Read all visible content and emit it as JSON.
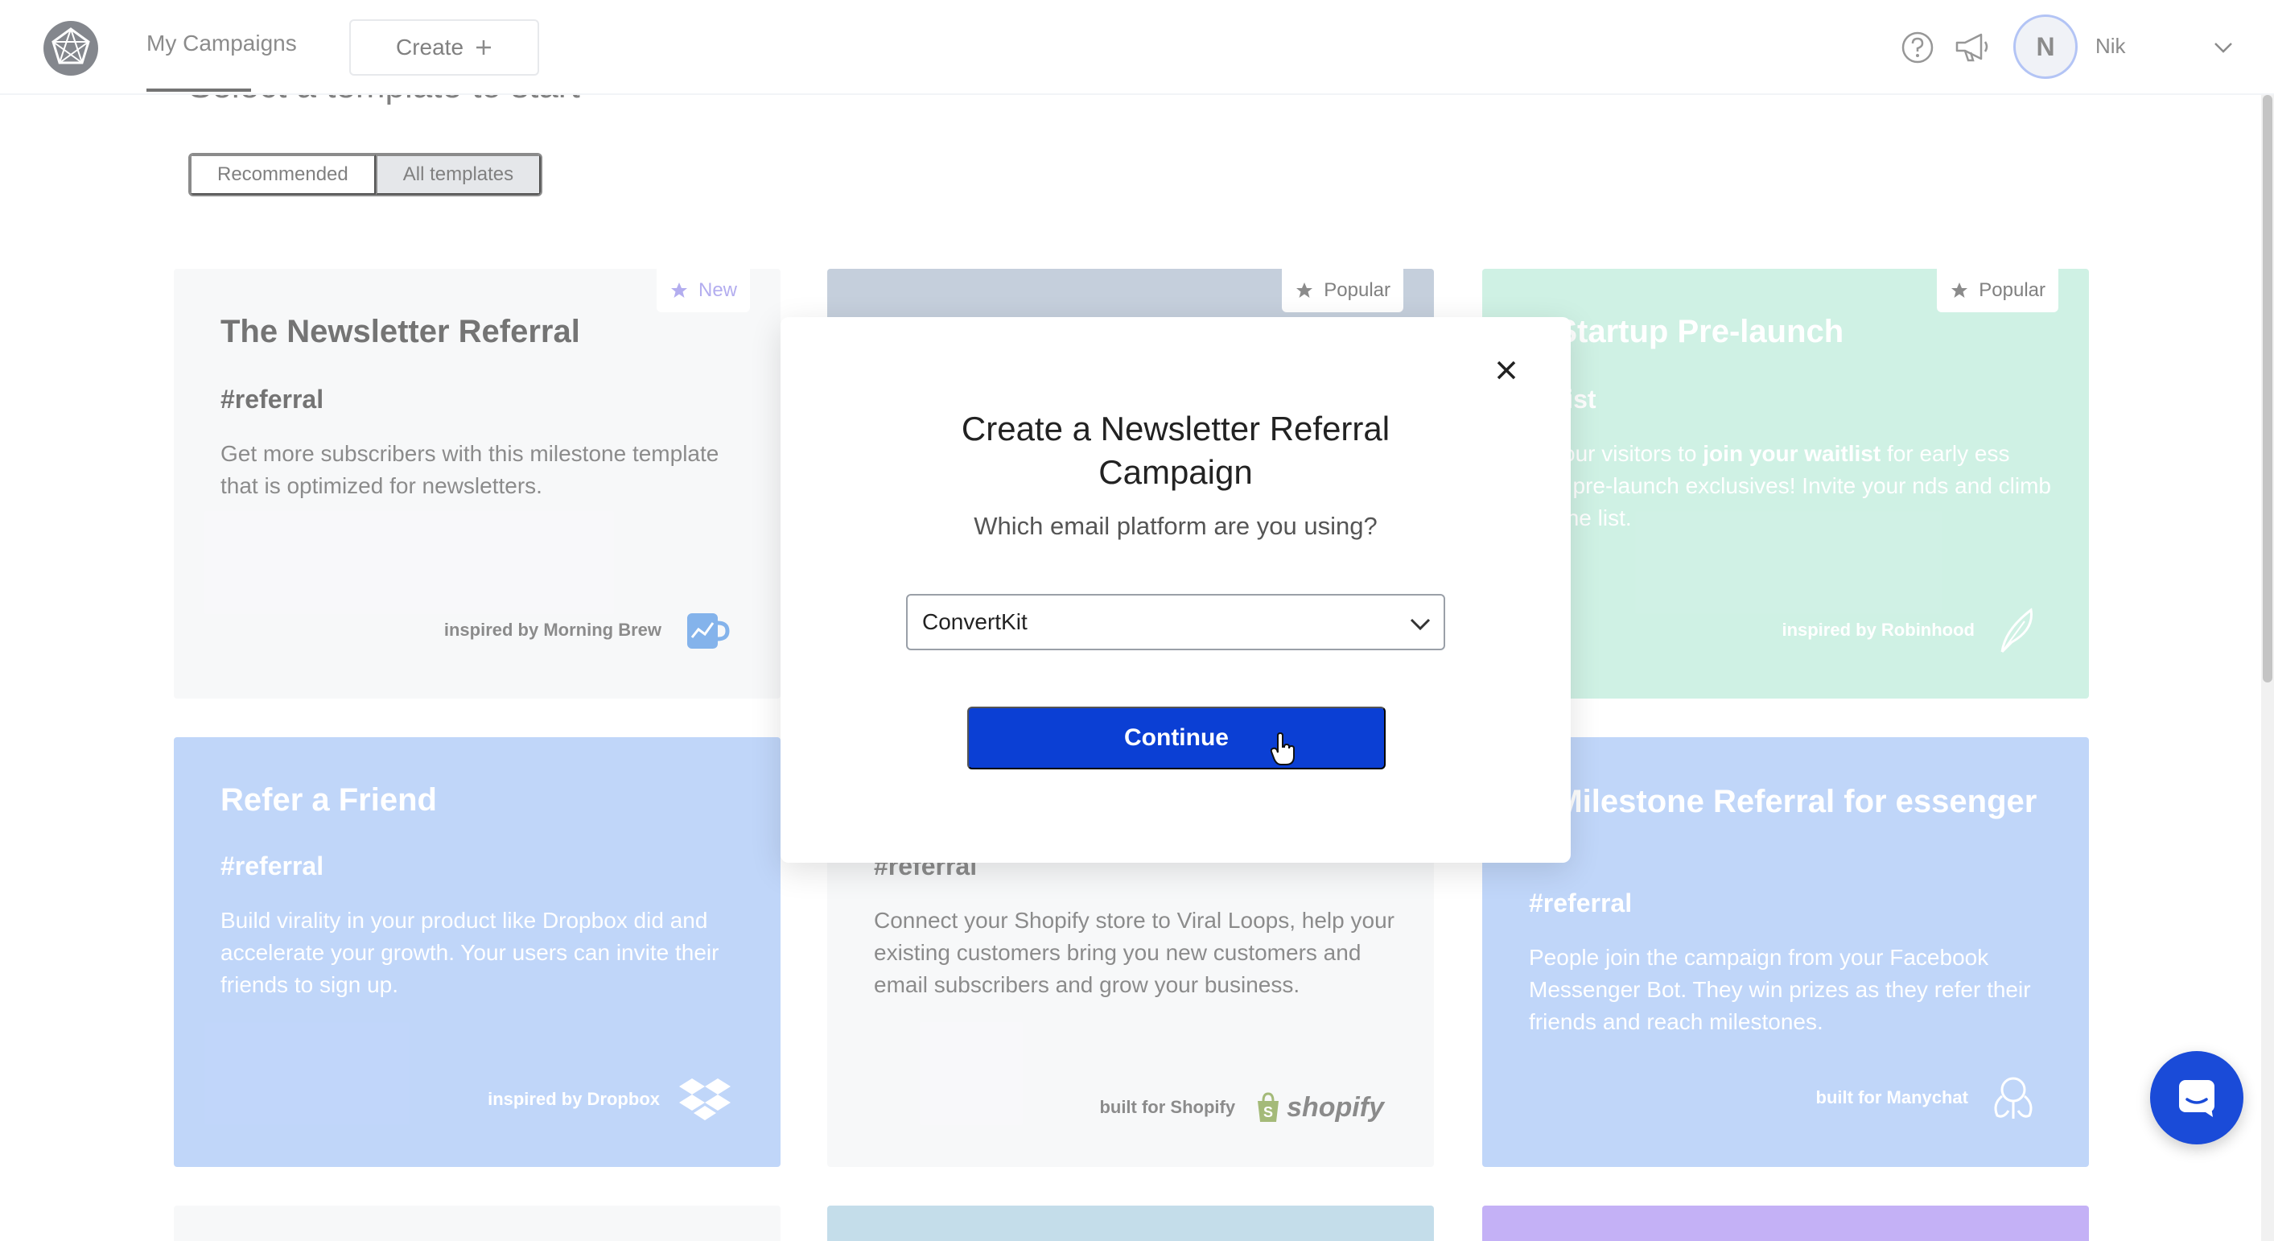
{
  "nav": {
    "my_campaigns": "My Campaigns",
    "create_label": "Create",
    "user_initial": "N",
    "user_name": "Nik"
  },
  "page": {
    "heading": "Select a template to start",
    "filters": [
      "Recommended",
      "All templates"
    ],
    "active_filter": "All templates"
  },
  "cards": [
    {
      "title": "The Newsletter Referral",
      "tag": "#referral",
      "description": "Get more subscribers with this milestone template that is optimized for newsletters.",
      "footer": "inspired by Morning Brew",
      "badge": "New",
      "icon": "mug-icon",
      "background": "#f4f5f7"
    },
    {
      "badge": "Popular",
      "background": "#aab9cc"
    },
    {
      "title": "e Startup Pre-launch",
      "tag": "aitlist",
      "description_parts": [
        "w your visitors to ",
        "join your waitlist",
        " for early ess and pre-launch exclusives! Invite your nds and climb up the list."
      ],
      "footer": "inspired by Robinhood",
      "badge": "Popular",
      "icon": "feather-icon",
      "background": "#b9ebd8"
    },
    {
      "title": "Refer a Friend",
      "tag": "#referral",
      "description": "Build virality in your product like Dropbox did and accelerate your growth. Your users can invite their friends to sign up.",
      "footer": "inspired by Dropbox",
      "icon": "dropbox-icon",
      "background": "#a3c3f7"
    },
    {
      "tag": "#referral",
      "description": "Connect your Shopify store to Viral Loops, help your existing customers bring you new customers and email subscribers and grow your business.",
      "footer": "built for Shopify",
      "brand": "shopify",
      "icon": "shopify-bag-icon",
      "background": "#f4f5f7"
    },
    {
      "title": "e Milestone Referral for essenger",
      "tag": "#referral",
      "description": "People join the campaign from your Facebook Messenger Bot. They win prizes as they refer their friends and reach milestones.",
      "footer": "built for Manychat",
      "icon": "manychat-icon",
      "background": "#a3c3f7"
    }
  ],
  "peek_colors": [
    "#f4f5f7",
    "#a9cde0",
    "#a88df2"
  ],
  "modal": {
    "title": "Create a Newsletter Referral Campaign",
    "subtitle": "Which email platform are you using?",
    "selected_platform": "ConvertKit",
    "continue_label": "Continue"
  },
  "colors": {
    "primary": "#0b3fd4",
    "chat": "#1a4bd8",
    "accent_badge": "#8f87e8"
  }
}
